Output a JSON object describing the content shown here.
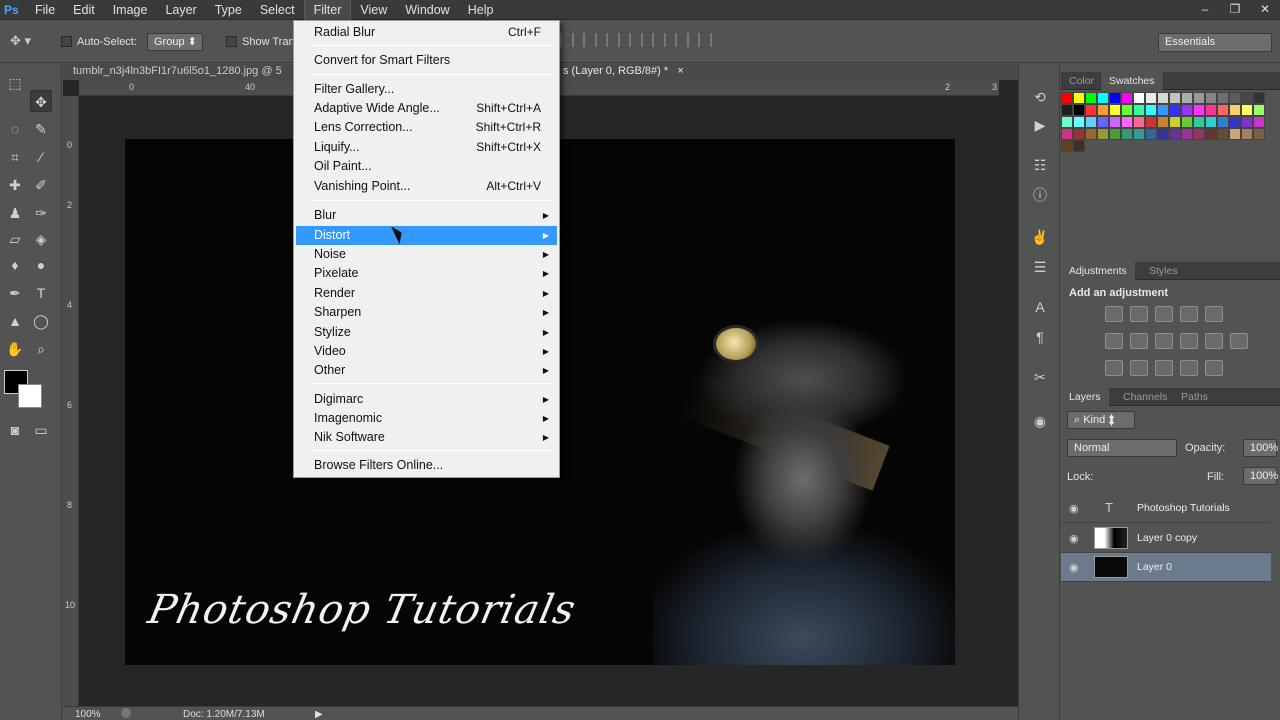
{
  "app": {
    "logo": "Ps"
  },
  "menubar": {
    "items": [
      "File",
      "Edit",
      "Image",
      "Layer",
      "Type",
      "Select",
      "Filter",
      "View",
      "Window",
      "Help"
    ],
    "active": "Filter"
  },
  "window_controls": {
    "minimize": "–",
    "restore": "❐",
    "close": "✕"
  },
  "options_bar": {
    "auto_select_label": "Auto-Select:",
    "auto_select_value": "Group",
    "show_transform_label": "Show Tran",
    "workspace": "Essentials"
  },
  "document": {
    "tab_title": "tumblr_n3j4ln3bFI1r7u6l5o1_1280.jpg @ 5",
    "tab_title_suffix": "s (Layer 0, RGB/8#) *",
    "tab_close": "×",
    "ruler_h": [
      "0",
      "40",
      "2",
      "3"
    ],
    "ruler_v": [
      "0",
      "2",
      "4",
      "6",
      "8",
      "10"
    ],
    "signature_text": "Photoshop Tutorials"
  },
  "status_bar": {
    "zoom": "100%",
    "doc_info": "Doc: 1.20M/7.13M",
    "arrow": "▶"
  },
  "filter_menu": {
    "items": [
      {
        "label": "Radial Blur",
        "shortcut": "Ctrl+F"
      },
      {
        "label": "Convert for Smart Filters",
        "shortcut": ""
      },
      {
        "label": "Filter Gallery...",
        "shortcut": ""
      },
      {
        "label": "Adaptive Wide Angle...",
        "shortcut": "Shift+Ctrl+A"
      },
      {
        "label": "Lens Correction...",
        "shortcut": "Shift+Ctrl+R"
      },
      {
        "label": "Liquify...",
        "shortcut": "Shift+Ctrl+X"
      },
      {
        "label": "Oil Paint...",
        "shortcut": ""
      },
      {
        "label": "Vanishing Point...",
        "shortcut": "Alt+Ctrl+V"
      },
      {
        "label": "Blur",
        "submenu": true
      },
      {
        "label": "Distort",
        "submenu": true,
        "highlighted": true
      },
      {
        "label": "Noise",
        "submenu": true
      },
      {
        "label": "Pixelate",
        "submenu": true
      },
      {
        "label": "Render",
        "submenu": true
      },
      {
        "label": "Sharpen",
        "submenu": true
      },
      {
        "label": "Stylize",
        "submenu": true
      },
      {
        "label": "Video",
        "submenu": true
      },
      {
        "label": "Other",
        "submenu": true
      },
      {
        "label": "Digimarc",
        "submenu": true
      },
      {
        "label": "Imagenomic",
        "submenu": true
      },
      {
        "label": "Nik Software",
        "submenu": true
      },
      {
        "label": "Browse Filters Online...",
        "shortcut": ""
      }
    ],
    "submenu_arrow": "▶"
  },
  "panels": {
    "color_tabs": [
      "Color",
      "Swatches"
    ],
    "active_color_tab": "Swatches",
    "adjustment_tabs": [
      "Adjustments",
      "Styles"
    ],
    "adjustments_title": "Add an adjustment",
    "layers_tabs": [
      "Layers",
      "Channels",
      "Paths"
    ],
    "kind_filter": "Kind",
    "blend_mode": "Normal",
    "opacity_label": "Opacity:",
    "opacity_value": "100%",
    "lock_label": "Lock:",
    "fill_label": "Fill:",
    "fill_value": "100%",
    "layers": [
      {
        "name": "Photoshop Tutorials",
        "type": "text",
        "selected": false
      },
      {
        "name": "Layer 0 copy",
        "type": "image",
        "selected": false
      },
      {
        "name": "Layer 0",
        "type": "image",
        "selected": true
      }
    ]
  },
  "swatch_colors": [
    "#ff0000",
    "#ffff00",
    "#00ff00",
    "#00ffff",
    "#0000ff",
    "#ff00ff",
    "#ffffff",
    "#ebebeb",
    "#d6d6d6",
    "#c2c2c2",
    "#adadad",
    "#999999",
    "#858585",
    "#707070",
    "#5c5c5c",
    "#474747",
    "#333333",
    "#1f1f1f",
    "#000000",
    "#ff3333",
    "#ff9933",
    "#ffff33",
    "#66ff33",
    "#33ff99",
    "#33ffff",
    "#3399ff",
    "#3333ff",
    "#9933ff",
    "#ff33ff",
    "#ff3399",
    "#ff6666",
    "#ffcc66",
    "#ffff66",
    "#99ff66",
    "#66ffcc",
    "#66ffff",
    "#66ccff",
    "#6666ff",
    "#cc66ff",
    "#ff66ff",
    "#ff6699",
    "#cc3333",
    "#cc8033",
    "#cccc33",
    "#66cc33",
    "#33cc99",
    "#33cccc",
    "#3380cc",
    "#3333cc",
    "#8033cc",
    "#cc33cc",
    "#cc3380",
    "#993333",
    "#996633",
    "#999933",
    "#4d9933",
    "#339973",
    "#339999",
    "#336699",
    "#333399",
    "#663399",
    "#993399",
    "#993366",
    "#663333",
    "#664d33",
    "#c8a878",
    "#a08060",
    "#806040",
    "#604020",
    "#403020"
  ],
  "tool_icons": [
    "move-tool",
    "marquee-tool",
    "lasso-tool",
    "quick-select-tool",
    "crop-tool",
    "eyedropper-tool",
    "healing-tool",
    "brush-tool",
    "clone-stamp-tool",
    "history-brush-tool",
    "eraser-tool",
    "paint-bucket-tool",
    "blur-tool",
    "dodge-tool",
    "pen-tool",
    "type-tool",
    "path-select-tool",
    "shape-tool",
    "hand-tool",
    "zoom-tool"
  ]
}
